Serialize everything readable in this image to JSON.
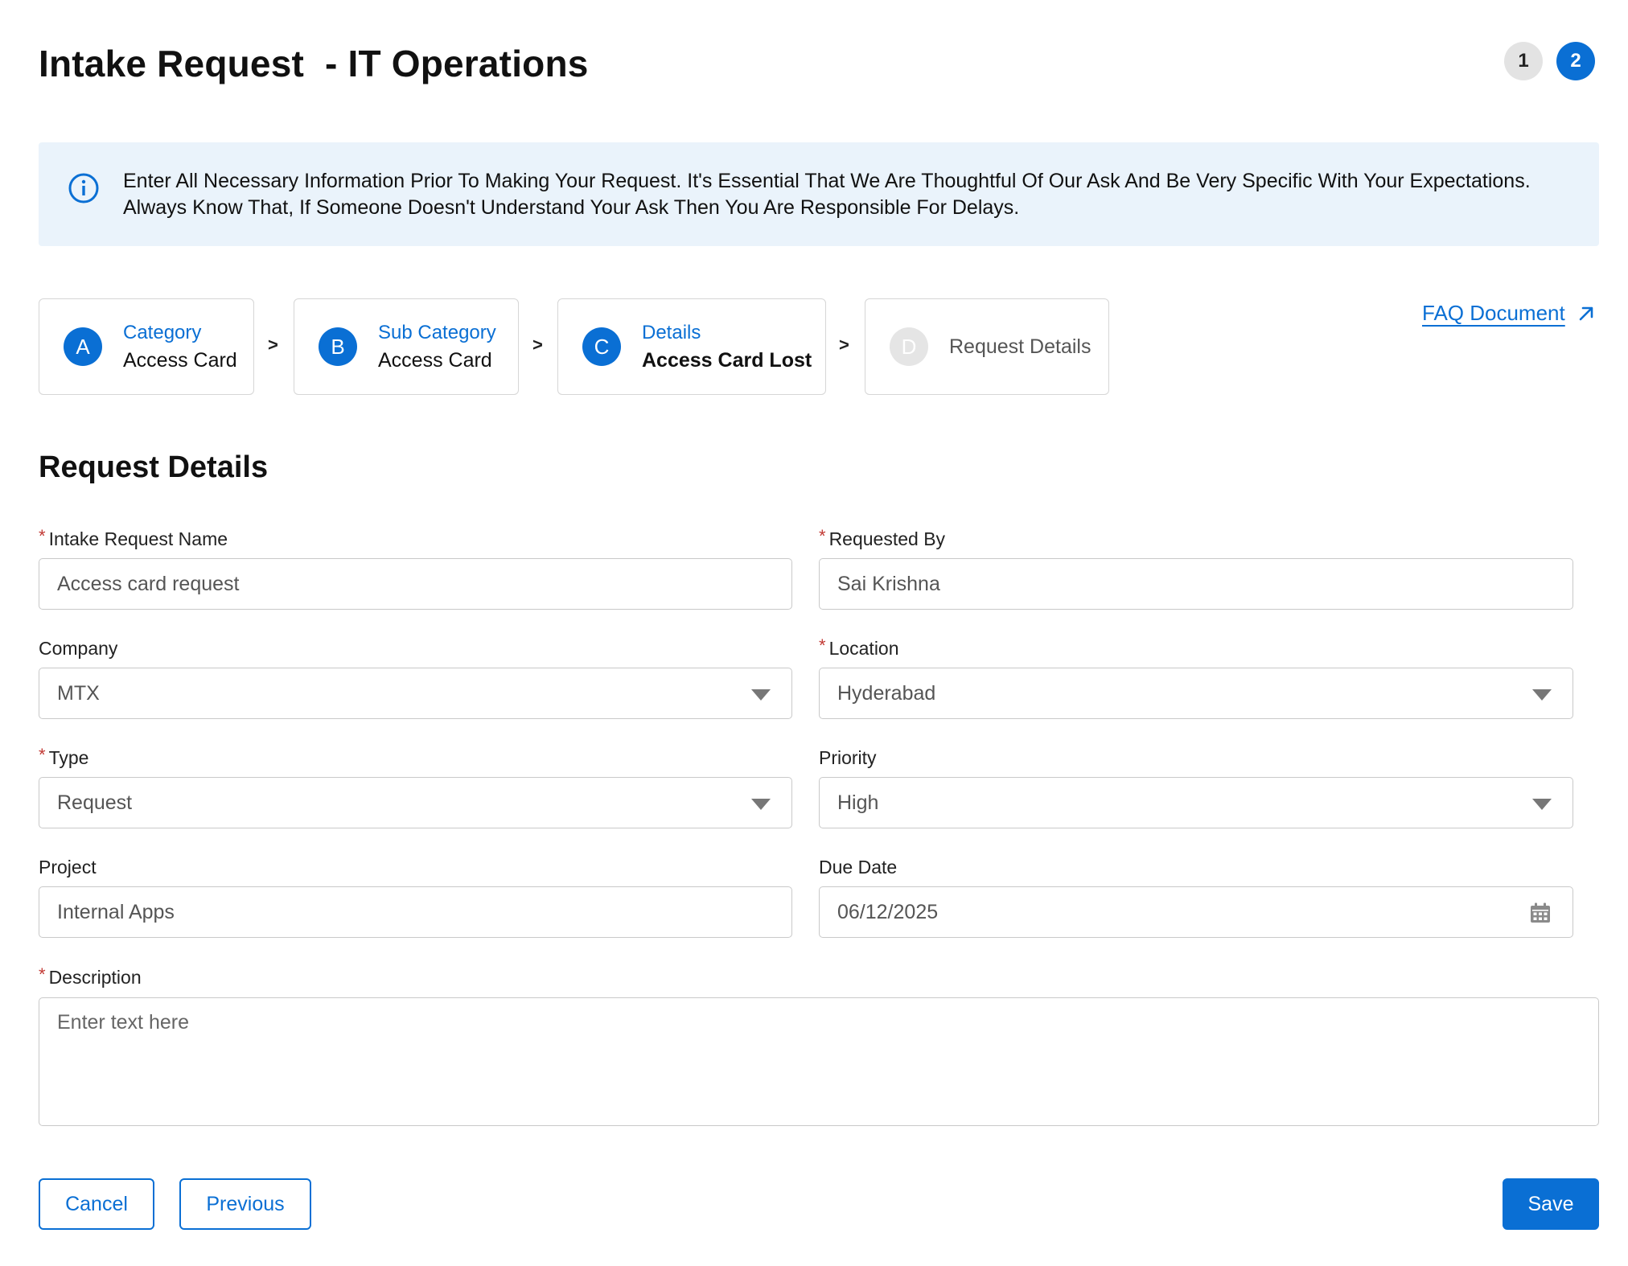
{
  "header": {
    "title": "Intake Request  - IT Operations",
    "steps": [
      "1",
      "2"
    ],
    "active_step": 2
  },
  "banner": {
    "icon": "info-icon",
    "text": "Enter All Necessary Information Prior To Making Your Request. It's Essential That We Are Thoughtful Of Our Ask And Be Very Specific With Your Expectations. Always Know That, If Someone Doesn't Understand Your Ask Then You Are Responsible For Delays."
  },
  "breadcrumb": {
    "separator": ">",
    "items": [
      {
        "badge": "A",
        "label": "Category",
        "value": "Access Card",
        "state": "complete"
      },
      {
        "badge": "B",
        "label": "Sub Category",
        "value": "Access Card",
        "state": "complete"
      },
      {
        "badge": "C",
        "label": "Details",
        "value": "Access Card Lost",
        "state": "complete"
      },
      {
        "badge": "D",
        "label": "Request Details",
        "state": "pending"
      }
    ]
  },
  "faq": {
    "label": "FAQ Document",
    "icon": "external-link-icon"
  },
  "section": {
    "title": "Request Details"
  },
  "fields": {
    "required_marker": "*",
    "intake_name": {
      "label": "Intake Request Name",
      "required": true,
      "value": "Access card request"
    },
    "requested_by": {
      "label": "Requested By",
      "required": true,
      "value": "Sai Krishna"
    },
    "company": {
      "label": "Company",
      "required": false,
      "value": "MTX"
    },
    "location": {
      "label": "Location",
      "required": true,
      "value": "Hyderabad"
    },
    "type": {
      "label": "Type",
      "required": true,
      "value": "Request"
    },
    "priority": {
      "label": "Priority",
      "required": false,
      "value": "High"
    },
    "project": {
      "label": "Project",
      "required": false,
      "value": "Internal Apps"
    },
    "due_date": {
      "label": "Due Date",
      "required": false,
      "value": "06/12/2025",
      "icon": "calendar-icon"
    },
    "description": {
      "label": "Description",
      "required": true,
      "placeholder": "Enter text here"
    }
  },
  "actions": {
    "cancel": "Cancel",
    "previous": "Previous",
    "save": "Save"
  },
  "colors": {
    "brand": "#0a6fd4",
    "banner_bg": "#eaf3fb",
    "required": "#c23934"
  }
}
